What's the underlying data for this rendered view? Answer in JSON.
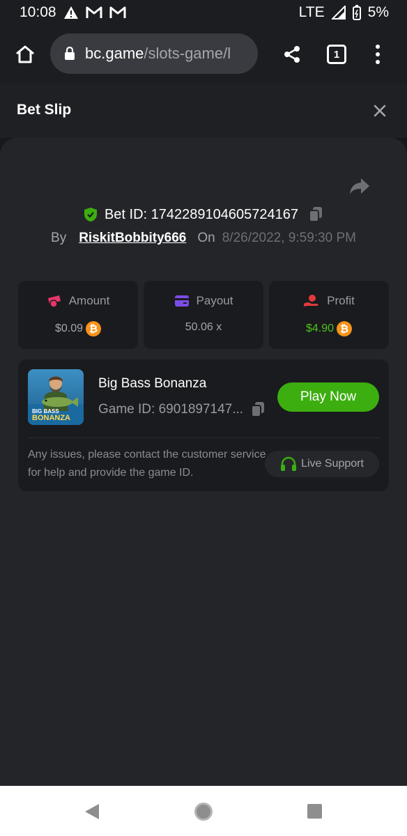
{
  "status_bar": {
    "time": "10:08",
    "network": "LTE",
    "battery": "5%",
    "icons": [
      "warning-icon",
      "gmail-icon",
      "gmail-icon",
      "signal-icon",
      "battery-icon"
    ]
  },
  "browser": {
    "url_host": "bc.game",
    "url_path": "/slots-game/l",
    "tab_count": "1"
  },
  "bet_slip": {
    "title": "Bet Slip",
    "bet_id_label": "Bet ID:",
    "bet_id": "1742289104605724167",
    "by_label": "By",
    "username": "RiskitBobbity666",
    "on_label": "On",
    "date": "8/26/2022, 9:59:30 PM"
  },
  "stats": {
    "amount": {
      "label": "Amount",
      "value": "$0.09"
    },
    "payout": {
      "label": "Payout",
      "value": "50.06 x"
    },
    "profit": {
      "label": "Profit",
      "value": "$4.90"
    }
  },
  "game": {
    "title": "Big Bass Bonanza",
    "game_id_text": "Game ID: 6901897147...",
    "thumb_text_line1": "BIG BASS",
    "thumb_text_line2": "BONANZA",
    "play_label": "Play Now",
    "issue_text": "Any issues, please contact the customer service for help and provide the game ID.",
    "support_label": "Live Support"
  },
  "colors": {
    "accent_green": "#3cae10",
    "profit_green": "#4fc11b",
    "btc_orange": "#f7931a",
    "amount_pink": "#e8356b",
    "payout_purple": "#7b4de8",
    "profit_red": "#e03a3a"
  }
}
